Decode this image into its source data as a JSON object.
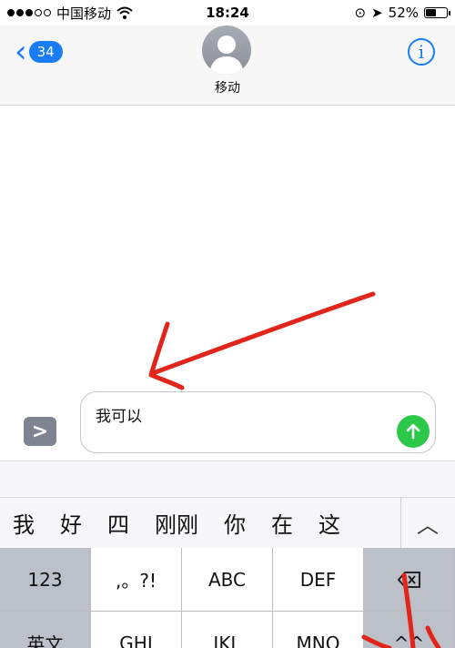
{
  "status_bar": {
    "carrier": "中国移动",
    "time": "18:24",
    "battery_percent": "52%",
    "battery_level": 0.52
  },
  "header": {
    "back_count": "34",
    "contact_name": "移动",
    "info_label": "i"
  },
  "composer": {
    "message_text": "我可以",
    "expand_symbol": ">"
  },
  "candidates": [
    "我",
    "好",
    "四",
    "刚刚",
    "你",
    "在",
    "这"
  ],
  "keyboard": {
    "row1": [
      "123",
      ",。?!",
      "ABC",
      "DEF"
    ],
    "row2": [
      "英文",
      "GHI",
      "JKL",
      "MNO",
      "^^"
    ]
  },
  "colors": {
    "accent_blue": "#1a7cf5",
    "send_green": "#2bc84a",
    "annotation_red": "#e1251b"
  }
}
